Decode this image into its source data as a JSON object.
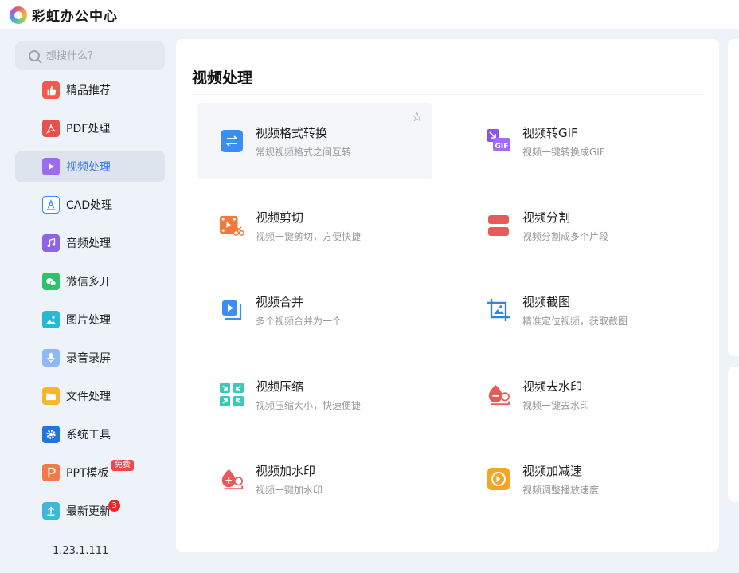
{
  "app": {
    "title": "彩虹办公中心"
  },
  "search": {
    "placeholder": "想搜什么?"
  },
  "sidebar": {
    "items": [
      {
        "label": "精品推荐",
        "icon": "thumbs-up-icon",
        "color": "#f05a4f",
        "active": false
      },
      {
        "label": "PDF处理",
        "icon": "pdf-icon",
        "color": "#e8514a",
        "active": false
      },
      {
        "label": "视频处理",
        "icon": "video-play-icon",
        "color": "#9b6cf0",
        "active": true
      },
      {
        "label": "CAD处理",
        "icon": "cad-icon",
        "color": "#3b8ef0",
        "active": false
      },
      {
        "label": "音频处理",
        "icon": "music-icon",
        "color": "#8f63e8",
        "active": false
      },
      {
        "label": "微信多开",
        "icon": "wechat-icon",
        "color": "#2ec26a",
        "active": false
      },
      {
        "label": "图片处理",
        "icon": "image-icon",
        "color": "#26b8d4",
        "active": false
      },
      {
        "label": "录音录屏",
        "icon": "microphone-icon",
        "color": "#6aa3f5",
        "active": false
      },
      {
        "label": "文件处理",
        "icon": "folder-icon",
        "color": "#f7b52c",
        "active": false
      },
      {
        "label": "系统工具",
        "icon": "gear-icon",
        "color": "#1f74e0",
        "active": false
      },
      {
        "label": "PPT模板",
        "icon": "ppt-icon",
        "color": "#f07a4a",
        "active": false,
        "badge": "免费"
      },
      {
        "label": "最新更新",
        "icon": "upload-icon",
        "color": "#3fb8d8",
        "active": false,
        "count": "3"
      }
    ]
  },
  "version": "1.23.1.111",
  "main": {
    "title": "视频处理",
    "tools": [
      {
        "title": "视频格式转换",
        "desc": "常规视频格式之间互转",
        "icon": "convert-arrows-icon",
        "color": "#3b8ef0"
      },
      {
        "title": "视频转GIF",
        "desc": "视频一键转换成GIF",
        "icon": "gif-icon",
        "color": "#8a55e8"
      },
      {
        "title": "视频剪切",
        "desc": "视频一键剪切，方便快捷",
        "icon": "scissors-film-icon",
        "color": "#f07a3a"
      },
      {
        "title": "视频分割",
        "desc": "视频分割成多个片段",
        "icon": "split-icon",
        "color": "#e85a5a"
      },
      {
        "title": "视频合并",
        "desc": "多个视频合并为一个",
        "icon": "merge-play-icon",
        "color": "#3b8ef0"
      },
      {
        "title": "视频截图",
        "desc": "精准定位视频，获取截图",
        "icon": "crop-image-icon",
        "color": "#2e86e0"
      },
      {
        "title": "视频压缩",
        "desc": "视频压缩大小，快速便捷",
        "icon": "compress-icon",
        "color": "#3ec8b8"
      },
      {
        "title": "视频去水印",
        "desc": "视频一键去水印",
        "icon": "remove-watermark-icon",
        "color": "#e85a5a"
      },
      {
        "title": "视频加水印",
        "desc": "视频一键加水印",
        "icon": "add-watermark-icon",
        "color": "#e85a5a"
      },
      {
        "title": "视频加减速",
        "desc": "视频调整播放速度",
        "icon": "speed-icon",
        "color": "#f5a524"
      }
    ]
  }
}
